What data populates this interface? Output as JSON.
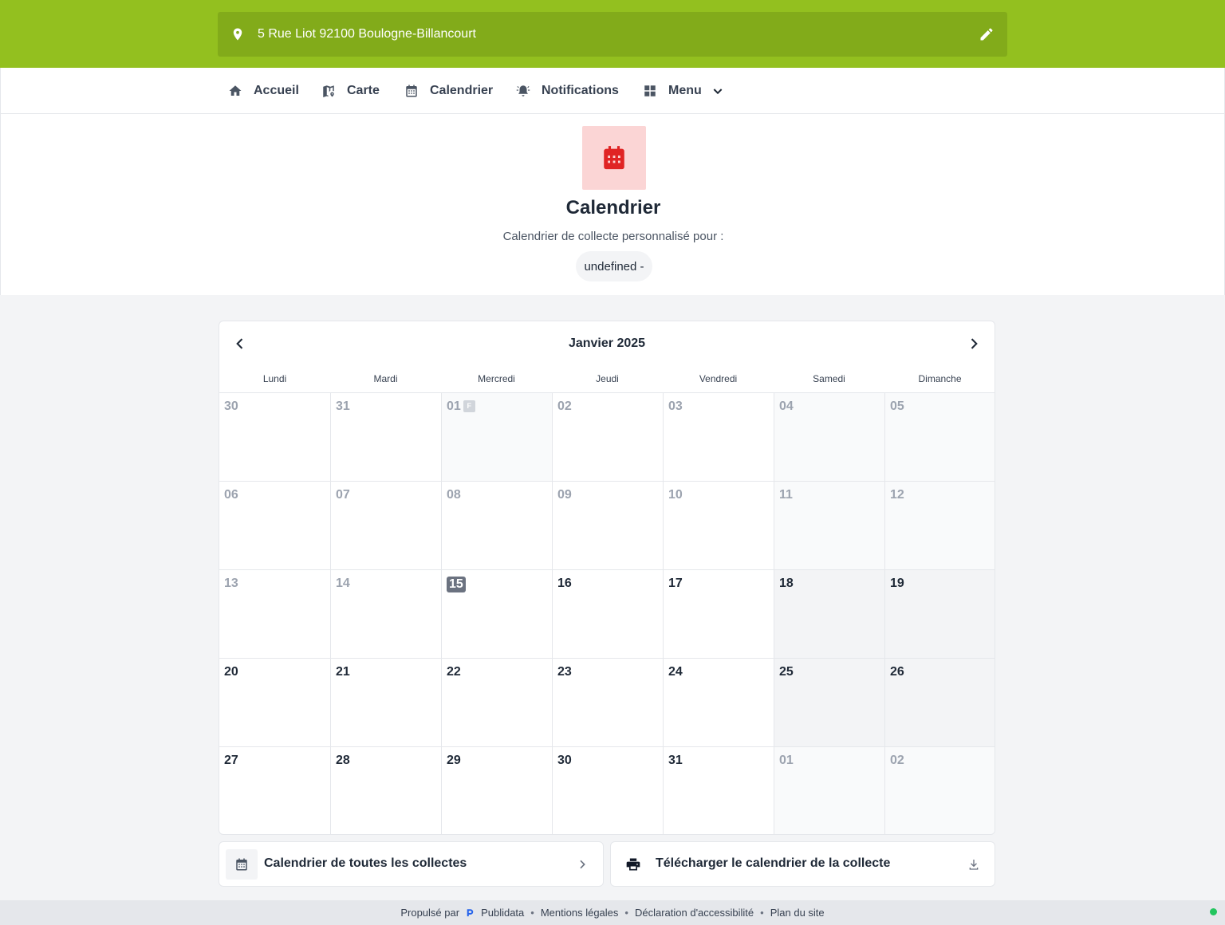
{
  "colors": {
    "brand_green": "#93c01f",
    "brand_green_dark": "#82ab1a",
    "calendar_red": "#e02424",
    "status_online": "#22c55e"
  },
  "address": {
    "text": "5 Rue Liot 92100 Boulogne-Billancourt",
    "pin_icon": "map-pin-icon",
    "edit_icon": "pencil-icon"
  },
  "nav": {
    "items": [
      {
        "label": "Accueil",
        "icon": "home-icon"
      },
      {
        "label": "Carte",
        "icon": "map-icon"
      },
      {
        "label": "Calendrier",
        "icon": "calendar-icon"
      },
      {
        "label": "Notifications",
        "icon": "bell-alert-icon"
      },
      {
        "label": "Menu",
        "icon": "grid-icon"
      }
    ]
  },
  "hero": {
    "title": "Calendrier",
    "subtitle": "Calendrier de collecte personnalisé pour :",
    "chip": "undefined -"
  },
  "calendar": {
    "month_label": "Janvier 2025",
    "weekdays": [
      "Lundi",
      "Mardi",
      "Mercredi",
      "Jeudi",
      "Vendredi",
      "Samedi",
      "Dimanche"
    ],
    "today": "15",
    "holiday_badge": "F",
    "weeks": [
      [
        "30",
        "31",
        "01",
        "02",
        "03",
        "04",
        "05"
      ],
      [
        "06",
        "07",
        "08",
        "09",
        "10",
        "11",
        "12"
      ],
      [
        "13",
        "14",
        "15",
        "16",
        "17",
        "18",
        "19"
      ],
      [
        "20",
        "21",
        "22",
        "23",
        "24",
        "25",
        "26"
      ],
      [
        "27",
        "28",
        "29",
        "30",
        "31",
        "01",
        "02"
      ]
    ]
  },
  "actions": {
    "all_collections": "Calendrier de toutes les collectes",
    "download": "Télécharger le calendrier de la collecte"
  },
  "footer": {
    "powered_by": "Propulsé par",
    "brand": "Publidata",
    "links": [
      "Mentions légales",
      "Déclaration d'accessibilité",
      "Plan du site"
    ]
  }
}
